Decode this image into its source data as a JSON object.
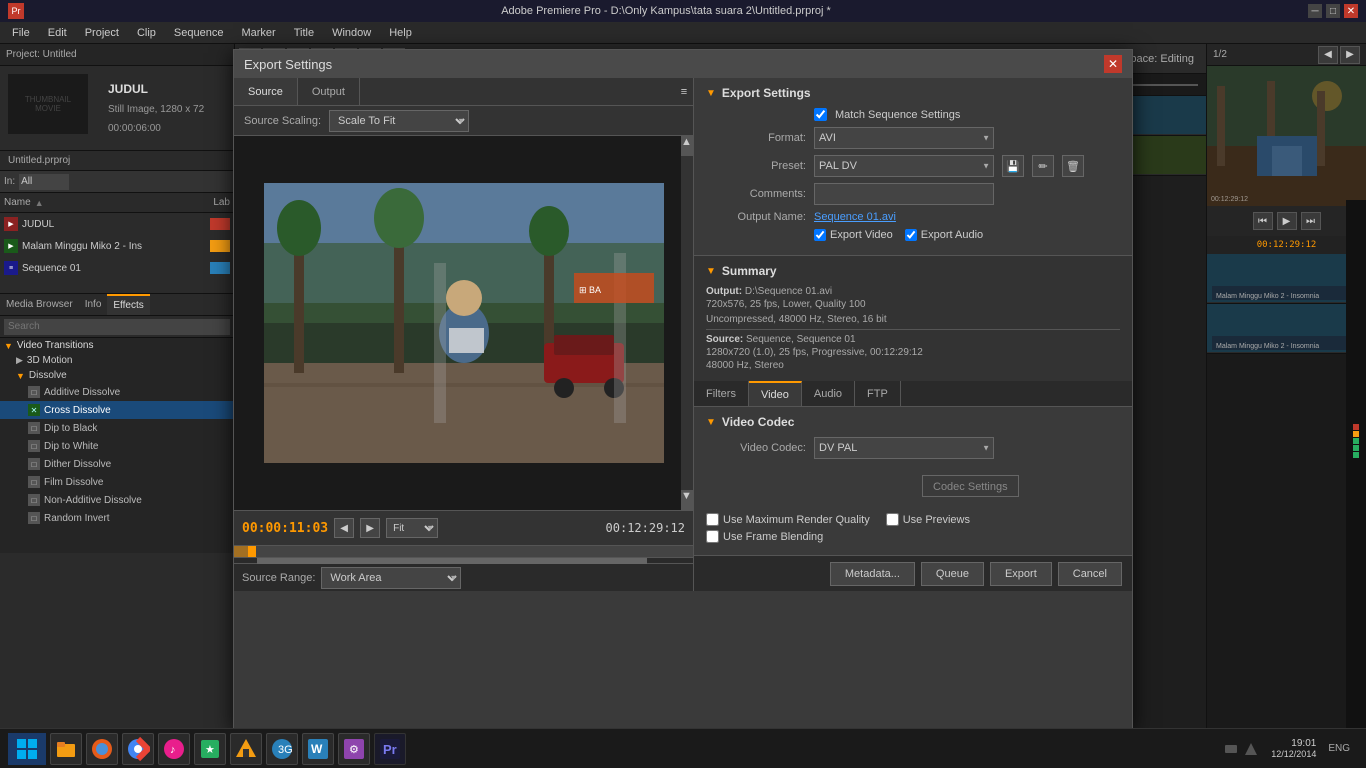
{
  "app": {
    "title": "Adobe Premiere Pro - D:\\Only Kampus\\tata suara 2\\Untitled.prproj *",
    "version": "Adobe Premiere Pro"
  },
  "titlebar": {
    "min": "─",
    "max": "□",
    "close": "✕"
  },
  "menu": {
    "items": [
      "File",
      "Edit",
      "Project",
      "Clip",
      "Sequence",
      "Marker",
      "Title",
      "Window",
      "Help"
    ]
  },
  "project": {
    "name": "Project: Untitled",
    "clip_title": "JUDUL",
    "clip_sub": "Still Image, 1280 x 72",
    "clip_duration": "00:00:06:00",
    "file_name": "Untitled.prproj",
    "search_label": "In:",
    "search_value": "All",
    "list_header": "Name",
    "items": [
      {
        "name": "JUDUL",
        "icon_color": "red"
      },
      {
        "name": "Malam Minggu Miko 2 - Ins",
        "icon_color": "green"
      },
      {
        "name": "Sequence 01",
        "icon_color": "blue"
      }
    ]
  },
  "panels": {
    "tabs": [
      "Media Browser",
      "Info",
      "Effects"
    ]
  },
  "effects": {
    "folders": [
      {
        "name": "Video Transitions",
        "open": true,
        "subfolders": [
          {
            "name": "3D Motion",
            "open": false
          },
          {
            "name": "Dissolve",
            "open": true,
            "items": [
              {
                "name": "Additive Dissolve",
                "selected": false
              },
              {
                "name": "Cross Dissolve",
                "selected": true
              },
              {
                "name": "Dip to Black",
                "selected": false
              },
              {
                "name": "Dip to White",
                "selected": false
              },
              {
                "name": "Dither Dissolve",
                "selected": false
              },
              {
                "name": "Film Dissolve",
                "selected": false
              },
              {
                "name": "Non-Additive Dissolve",
                "selected": false
              },
              {
                "name": "Random Invert",
                "selected": false
              }
            ]
          }
        ]
      }
    ]
  },
  "workspace": {
    "label": "Workspace: Editing"
  },
  "dialog": {
    "title": "Export Settings",
    "tabs": [
      "Source",
      "Output"
    ],
    "active_tab": "Source",
    "source_scaling_label": "Source Scaling:",
    "source_scaling_value": "Scale To Fit",
    "timecode_current": "00:00:11:03",
    "timecode_total": "00:12:29:12",
    "fit_label": "Fit",
    "source_range_label": "Source Range:",
    "source_range_value": "Work Area",
    "export_settings": {
      "section_title": "Export Settings",
      "match_sequence": "Match Sequence Settings",
      "format_label": "Format:",
      "format_value": "AVI",
      "preset_label": "Preset:",
      "preset_value": "PAL DV",
      "comments_label": "Comments:",
      "output_name_label": "Output Name:",
      "output_name_value": "Sequence 01.avi",
      "export_video_label": "Export Video",
      "export_audio_label": "Export Audio"
    },
    "summary": {
      "section_title": "Summary",
      "output_label": "Output:",
      "output_path": "D:\\Sequence 01.avi",
      "output_specs": "720x576, 25 fps, Lower, Quality 100",
      "output_audio": "Uncompressed, 48000 Hz, Stereo, 16 bit",
      "source_label": "Source:",
      "source_value": "Sequence, Sequence 01",
      "source_specs": "1280x720 (1.0), 25 fps, Progressive, 00:12:29:12",
      "source_audio": "48000 Hz, Stereo"
    },
    "codec_tabs": [
      "Filters",
      "Video",
      "Audio",
      "FTP"
    ],
    "active_codec_tab": "Video",
    "video_codec": {
      "section_title": "Video Codec",
      "codec_label": "Video Codec:",
      "codec_value": "DV PAL",
      "codec_settings_btn": "Codec Settings"
    },
    "options": {
      "use_max_render": "Use Maximum Render Quality",
      "use_previews": "Use Previews",
      "use_frame_blending": "Use Frame Blending"
    },
    "footer": {
      "metadata_btn": "Metadata...",
      "queue_btn": "Queue",
      "export_btn": "Export",
      "cancel_btn": "Cancel"
    }
  },
  "right_panel": {
    "header": "1/2",
    "timecode": "00:12:29:12"
  },
  "taskbar": {
    "time": "19:01",
    "date": "12/12/2014",
    "lang": "ENG"
  }
}
